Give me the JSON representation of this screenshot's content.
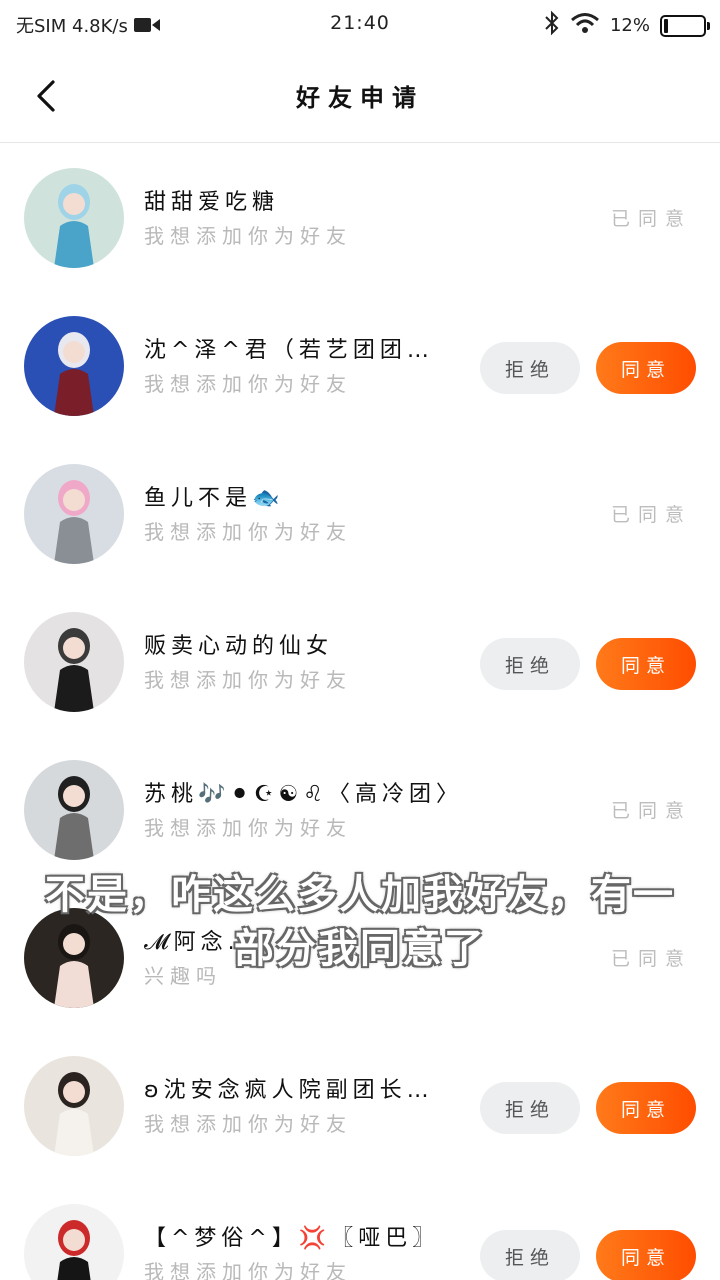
{
  "status_bar": {
    "carrier": "无SIM 4.8K/s",
    "time": "21:40",
    "battery": "12%",
    "battery_level": 0.12
  },
  "header": {
    "title": "好友申请",
    "back_icon": "chevron-left-icon"
  },
  "buttons": {
    "reject": "拒绝",
    "accept": "同意",
    "agreed": "已同意"
  },
  "requests": [
    {
      "name": "甜甜爱吃糖",
      "message": "我想添加你为好友",
      "status": "agreed"
    },
    {
      "name": "沈^泽^君（若艺团团…",
      "message": "我想添加你为好友",
      "status": "pending"
    },
    {
      "name": "鱼儿不是🐟",
      "message": "我想添加你为好友",
      "status": "agreed"
    },
    {
      "name": "贩卖心动的仙女",
      "message": "我想添加你为好友",
      "status": "pending"
    },
    {
      "name": "苏桃🎶⚫☪☯♌〈高冷团〉",
      "message": "我想添加你为好友",
      "status": "agreed"
    },
    {
      "name": "𝓜阿念...",
      "message": "兴趣吗",
      "status": "agreed"
    },
    {
      "name": "ʚ沈安念疯人院副团长…",
      "message": "我想添加你为好友",
      "status": "pending"
    },
    {
      "name": "【^梦俗^】💢〖哑巴〗",
      "message": "我想添加你为好友",
      "status": "pending"
    }
  ],
  "subtitle": {
    "line1": "不是，咋这么多人加我好友，有一",
    "line2": "部分我同意了"
  },
  "colors": {
    "accent": "#ff5a0a",
    "reject_bg": "#eceef0",
    "muted_text": "#b9b9b9"
  }
}
